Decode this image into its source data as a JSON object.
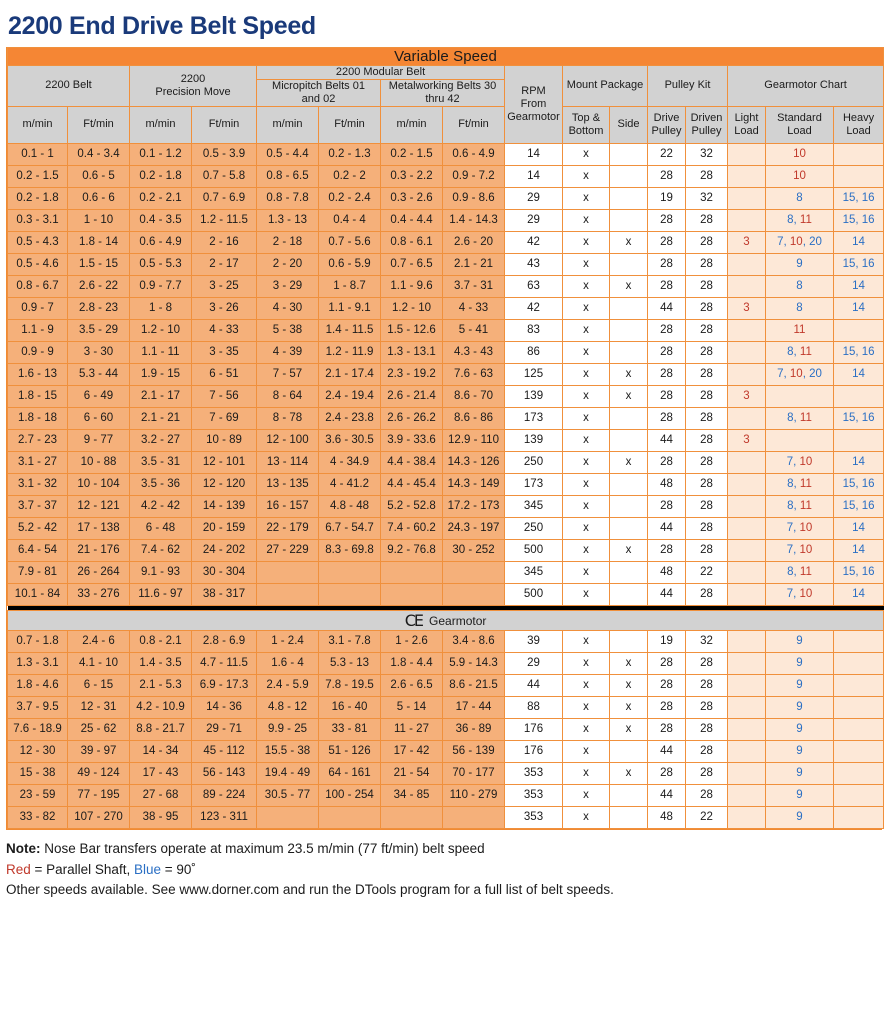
{
  "page_title": "2200 End Drive Belt Speed",
  "colors": {
    "orange_banner": "#f58634",
    "title_blue": "#1a3a7a",
    "parallel_shaft_red": "#c0392b",
    "ninety_degree_blue": "#2a6fc4",
    "speed_cell": "#f5b07a",
    "header_gray": "#d2d2d2",
    "tint_cell": "#fde8d7"
  },
  "banner": {
    "variable_speed": "Variable Speed"
  },
  "ce_section": {
    "mark": "CE",
    "label": "Gearmotor"
  },
  "headers": {
    "group_2200_belt": "2200 Belt",
    "group_precision_move": "2200\nPrecision Move",
    "group_precision_move_l1": "2200",
    "group_precision_move_l2": "Precision Move",
    "group_modular_belt": "2200 Modular Belt",
    "group_micropitch": "Micropitch Belts 01 and 02",
    "group_micropitch_l1": "Micropitch Belts 01",
    "group_micropitch_l2": "and 02",
    "group_metalworking": "Metalworking Belts 30 thru 42",
    "group_metalworking_l1": "Metalworking Belts 30",
    "group_metalworking_l2": "thru 42",
    "rpm_from_gearmotor": "RPM\nFrom\nGearmotor",
    "rpm_l1": "RPM",
    "rpm_l2": "From",
    "rpm_l3": "Gearmotor",
    "mount_package": "Mount Package",
    "top_and_bottom_l1": "Top &",
    "top_and_bottom_l2": "Bottom",
    "side": "Side",
    "pulley_kit": "Pulley Kit",
    "drive_pulley_l1": "Drive",
    "drive_pulley_l2": "Pulley",
    "driven_pulley_l1": "Driven",
    "driven_pulley_l2": "Pulley",
    "gearmotor_chart": "Gearmotor Chart",
    "light_load_l1": "Light",
    "light_load_l2": "Load",
    "standard_load_l1": "Standard",
    "standard_load_l2": "Load",
    "heavy_load_l1": "Heavy",
    "heavy_load_l2": "Load",
    "unit_mmin": "m/min",
    "unit_ftmin": "Ft/min"
  },
  "variable_speed_rows": [
    {
      "belt_m": "0.1 - 1",
      "belt_ft": "0.4 - 3.4",
      "pm_m": "0.1 - 1.2",
      "pm_ft": "0.5 - 3.9",
      "mp_m": "0.5 - 4.4",
      "mp_ft": "0.2 - 1.3",
      "mw_m": "0.2 - 1.5",
      "mw_ft": "0.6 - 4.9",
      "rpm": "14",
      "top": "x",
      "side": "",
      "drive": "22",
      "driven": "32",
      "light": "",
      "standard": [
        {
          "t": "10",
          "c": "red"
        }
      ],
      "heavy": []
    },
    {
      "belt_m": "0.2 - 1.5",
      "belt_ft": "0.6 - 5",
      "pm_m": "0.2 - 1.8",
      "pm_ft": "0.7 - 5.8",
      "mp_m": "0.8 - 6.5",
      "mp_ft": "0.2 - 2",
      "mw_m": "0.3 - 2.2",
      "mw_ft": "0.9 - 7.2",
      "rpm": "14",
      "top": "x",
      "side": "",
      "drive": "28",
      "driven": "28",
      "light": "",
      "standard": [
        {
          "t": "10",
          "c": "red"
        }
      ],
      "heavy": []
    },
    {
      "belt_m": "0.2 - 1.8",
      "belt_ft": "0.6 - 6",
      "pm_m": "0.2 - 2.1",
      "pm_ft": "0.7 - 6.9",
      "mp_m": "0.8 - 7.8",
      "mp_ft": "0.2 - 2.4",
      "mw_m": "0.3 - 2.6",
      "mw_ft": "0.9 - 8.6",
      "rpm": "29",
      "top": "x",
      "side": "",
      "drive": "19",
      "driven": "32",
      "light": "",
      "standard": [
        {
          "t": "8",
          "c": "blue"
        }
      ],
      "heavy": [
        {
          "t": "15, 16",
          "c": "blue"
        }
      ]
    },
    {
      "belt_m": "0.3 - 3.1",
      "belt_ft": "1 - 10",
      "pm_m": "0.4 - 3.5",
      "pm_ft": "1.2 - 11.5",
      "mp_m": "1.3 - 13",
      "mp_ft": "0.4 - 4",
      "mw_m": "0.4 - 4.4",
      "mw_ft": "1.4 - 14.3",
      "rpm": "29",
      "top": "x",
      "side": "",
      "drive": "28",
      "driven": "28",
      "light": "",
      "standard": [
        {
          "t": "8",
          "c": "blue"
        },
        {
          "t": ", ",
          "c": "blue"
        },
        {
          "t": "11",
          "c": "red"
        }
      ],
      "heavy": [
        {
          "t": "15, 16",
          "c": "blue"
        }
      ]
    },
    {
      "belt_m": "0.5 - 4.3",
      "belt_ft": "1.8 - 14",
      "pm_m": "0.6 - 4.9",
      "pm_ft": "2 - 16",
      "mp_m": "2 - 18",
      "mp_ft": "0.7 - 5.6",
      "mw_m": "0.8 - 6.1",
      "mw_ft": "2.6 - 20",
      "rpm": "42",
      "top": "x",
      "side": "x",
      "drive": "28",
      "driven": "28",
      "light": [
        {
          "t": "3",
          "c": "red"
        }
      ],
      "standard": [
        {
          "t": "7",
          "c": "blue"
        },
        {
          "t": ", ",
          "c": "blue"
        },
        {
          "t": "10",
          "c": "red"
        },
        {
          "t": ", ",
          "c": "blue"
        },
        {
          "t": "20",
          "c": "blue"
        }
      ],
      "heavy": [
        {
          "t": "14",
          "c": "blue"
        }
      ]
    },
    {
      "belt_m": "0.5 - 4.6",
      "belt_ft": "1.5 - 15",
      "pm_m": "0.5 - 5.3",
      "pm_ft": "2 - 17",
      "mp_m": "2 - 20",
      "mp_ft": "0.6 - 5.9",
      "mw_m": "0.7 - 6.5",
      "mw_ft": "2.1 - 21",
      "rpm": "43",
      "top": "x",
      "side": "",
      "drive": "28",
      "driven": "28",
      "light": "",
      "standard": [
        {
          "t": "9",
          "c": "blue"
        }
      ],
      "heavy": [
        {
          "t": "15, 16",
          "c": "blue"
        }
      ]
    },
    {
      "belt_m": "0.8 - 6.7",
      "belt_ft": "2.6 - 22",
      "pm_m": "0.9 - 7.7",
      "pm_ft": "3 - 25",
      "mp_m": "3 - 29",
      "mp_ft": "1 - 8.7",
      "mw_m": "1.1 - 9.6",
      "mw_ft": "3.7 - 31",
      "rpm": "63",
      "top": "x",
      "side": "x",
      "drive": "28",
      "driven": "28",
      "light": "",
      "standard": [
        {
          "t": "8",
          "c": "blue"
        }
      ],
      "heavy": [
        {
          "t": "14",
          "c": "blue"
        }
      ]
    },
    {
      "belt_m": "0.9 - 7",
      "belt_ft": "2.8 - 23",
      "pm_m": "1 - 8",
      "pm_ft": "3 - 26",
      "mp_m": "4 - 30",
      "mp_ft": "1.1 - 9.1",
      "mw_m": "1.2 - 10",
      "mw_ft": "4 - 33",
      "rpm": "42",
      "top": "x",
      "side": "",
      "drive": "44",
      "driven": "28",
      "light": [
        {
          "t": "3",
          "c": "red"
        }
      ],
      "standard": [
        {
          "t": "8",
          "c": "blue"
        }
      ],
      "heavy": [
        {
          "t": "14",
          "c": "blue"
        }
      ]
    },
    {
      "belt_m": "1.1 - 9",
      "belt_ft": "3.5 - 29",
      "pm_m": "1.2 - 10",
      "pm_ft": "4 - 33",
      "mp_m": "5 - 38",
      "mp_ft": "1.4 - 11.5",
      "mw_m": "1.5 - 12.6",
      "mw_ft": "5 - 41",
      "rpm": "83",
      "top": "x",
      "side": "",
      "drive": "28",
      "driven": "28",
      "light": "",
      "standard": [
        {
          "t": "11",
          "c": "red"
        }
      ],
      "heavy": []
    },
    {
      "belt_m": "0.9 - 9",
      "belt_ft": "3 - 30",
      "pm_m": "1.1 - 11",
      "pm_ft": "3 - 35",
      "mp_m": "4 - 39",
      "mp_ft": "1.2 - 11.9",
      "mw_m": "1.3 - 13.1",
      "mw_ft": "4.3 - 43",
      "rpm": "86",
      "top": "x",
      "side": "",
      "drive": "28",
      "driven": "28",
      "light": "",
      "standard": [
        {
          "t": "8",
          "c": "blue"
        },
        {
          "t": ", ",
          "c": "blue"
        },
        {
          "t": "11",
          "c": "red"
        }
      ],
      "heavy": [
        {
          "t": "15, 16",
          "c": "blue"
        }
      ]
    },
    {
      "belt_m": "1.6 - 13",
      "belt_ft": "5.3 - 44",
      "pm_m": "1.9 - 15",
      "pm_ft": "6 - 51",
      "mp_m": "7 - 57",
      "mp_ft": "2.1 - 17.4",
      "mw_m": "2.3 - 19.2",
      "mw_ft": "7.6 - 63",
      "rpm": "125",
      "top": "x",
      "side": "x",
      "drive": "28",
      "driven": "28",
      "light": "",
      "standard": [
        {
          "t": "7",
          "c": "blue"
        },
        {
          "t": ", ",
          "c": "blue"
        },
        {
          "t": "10",
          "c": "red"
        },
        {
          "t": ", ",
          "c": "blue"
        },
        {
          "t": "20",
          "c": "blue"
        }
      ],
      "heavy": [
        {
          "t": "14",
          "c": "blue"
        }
      ]
    },
    {
      "belt_m": "1.8 - 15",
      "belt_ft": "6 - 49",
      "pm_m": "2.1 - 17",
      "pm_ft": "7 - 56",
      "mp_m": "8 - 64",
      "mp_ft": "2.4 - 19.4",
      "mw_m": "2.6 - 21.4",
      "mw_ft": "8.6 - 70",
      "rpm": "139",
      "top": "x",
      "side": "x",
      "drive": "28",
      "driven": "28",
      "light": [
        {
          "t": "3",
          "c": "red"
        }
      ],
      "standard": [],
      "heavy": []
    },
    {
      "belt_m": "1.8 - 18",
      "belt_ft": "6 - 60",
      "pm_m": "2.1 - 21",
      "pm_ft": "7 - 69",
      "mp_m": "8 - 78",
      "mp_ft": "2.4 - 23.8",
      "mw_m": "2.6 - 26.2",
      "mw_ft": "8.6 - 86",
      "rpm": "173",
      "top": "x",
      "side": "",
      "drive": "28",
      "driven": "28",
      "light": "",
      "standard": [
        {
          "t": "8",
          "c": "blue"
        },
        {
          "t": ", ",
          "c": "blue"
        },
        {
          "t": "11",
          "c": "red"
        }
      ],
      "heavy": [
        {
          "t": "15, 16",
          "c": "blue"
        }
      ]
    },
    {
      "belt_m": "2.7 - 23",
      "belt_ft": "9 - 77",
      "pm_m": "3.2 - 27",
      "pm_ft": "10 - 89",
      "mp_m": "12 - 100",
      "mp_ft": "3.6 - 30.5",
      "mw_m": "3.9 - 33.6",
      "mw_ft": "12.9 - 110",
      "rpm": "139",
      "top": "x",
      "side": "",
      "drive": "44",
      "driven": "28",
      "light": [
        {
          "t": "3",
          "c": "red"
        }
      ],
      "standard": [],
      "heavy": []
    },
    {
      "belt_m": "3.1 - 27",
      "belt_ft": "10 - 88",
      "pm_m": "3.5 - 31",
      "pm_ft": "12 - 101",
      "mp_m": "13 - 114",
      "mp_ft": "4 - 34.9",
      "mw_m": "4.4 - 38.4",
      "mw_ft": "14.3 - 126",
      "rpm": "250",
      "top": "x",
      "side": "x",
      "drive": "28",
      "driven": "28",
      "light": "",
      "standard": [
        {
          "t": "7",
          "c": "blue"
        },
        {
          "t": ", ",
          "c": "blue"
        },
        {
          "t": "10",
          "c": "red"
        }
      ],
      "heavy": [
        {
          "t": "14",
          "c": "blue"
        }
      ]
    },
    {
      "belt_m": "3.1 - 32",
      "belt_ft": "10 - 104",
      "pm_m": "3.5 - 36",
      "pm_ft": "12 - 120",
      "mp_m": "13 - 135",
      "mp_ft": "4 - 41.2",
      "mw_m": "4.4 - 45.4",
      "mw_ft": "14.3 - 149",
      "rpm": "173",
      "top": "x",
      "side": "",
      "drive": "48",
      "driven": "28",
      "light": "",
      "standard": [
        {
          "t": "8",
          "c": "blue"
        },
        {
          "t": ", ",
          "c": "blue"
        },
        {
          "t": "11",
          "c": "red"
        }
      ],
      "heavy": [
        {
          "t": "15, 16",
          "c": "blue"
        }
      ]
    },
    {
      "belt_m": "3.7 - 37",
      "belt_ft": "12 - 121",
      "pm_m": "4.2 - 42",
      "pm_ft": "14 - 139",
      "mp_m": "16 - 157",
      "mp_ft": "4.8 - 48",
      "mw_m": "5.2 - 52.8",
      "mw_ft": "17.2 - 173",
      "rpm": "345",
      "top": "x",
      "side": "",
      "drive": "28",
      "driven": "28",
      "light": "",
      "standard": [
        {
          "t": "8",
          "c": "blue"
        },
        {
          "t": ", ",
          "c": "blue"
        },
        {
          "t": "11",
          "c": "red"
        }
      ],
      "heavy": [
        {
          "t": "15, 16",
          "c": "blue"
        }
      ]
    },
    {
      "belt_m": "5.2 - 42",
      "belt_ft": "17 - 138",
      "pm_m": "6 - 48",
      "pm_ft": "20 - 159",
      "mp_m": "22 - 179",
      "mp_ft": "6.7 - 54.7",
      "mw_m": "7.4 - 60.2",
      "mw_ft": "24.3 - 197",
      "rpm": "250",
      "top": "x",
      "side": "",
      "drive": "44",
      "driven": "28",
      "light": "",
      "standard": [
        {
          "t": "7",
          "c": "blue"
        },
        {
          "t": ", ",
          "c": "blue"
        },
        {
          "t": "10",
          "c": "red"
        }
      ],
      "heavy": [
        {
          "t": "14",
          "c": "blue"
        }
      ]
    },
    {
      "belt_m": "6.4 - 54",
      "belt_ft": "21 - 176",
      "pm_m": "7.4 - 62",
      "pm_ft": "24 - 202",
      "mp_m": "27 - 229",
      "mp_ft": "8.3 - 69.8",
      "mw_m": "9.2 - 76.8",
      "mw_ft": "30 - 252",
      "rpm": "500",
      "top": "x",
      "side": "x",
      "drive": "28",
      "driven": "28",
      "light": "",
      "standard": [
        {
          "t": "7",
          "c": "blue"
        },
        {
          "t": ", ",
          "c": "blue"
        },
        {
          "t": "10",
          "c": "red"
        }
      ],
      "heavy": [
        {
          "t": "14",
          "c": "blue"
        }
      ]
    },
    {
      "belt_m": "7.9 - 81",
      "belt_ft": "26 - 264",
      "pm_m": "9.1 - 93",
      "pm_ft": "30 - 304",
      "mp_m": "",
      "mp_ft": "",
      "mw_m": "",
      "mw_ft": "",
      "rpm": "345",
      "top": "x",
      "side": "",
      "drive": "48",
      "driven": "22",
      "light": "",
      "standard": [
        {
          "t": "8",
          "c": "blue"
        },
        {
          "t": ", ",
          "c": "blue"
        },
        {
          "t": "11",
          "c": "red"
        }
      ],
      "heavy": [
        {
          "t": "15, 16",
          "c": "blue"
        }
      ]
    },
    {
      "belt_m": "10.1 - 84",
      "belt_ft": "33 - 276",
      "pm_m": "11.6 - 97",
      "pm_ft": "38 - 317",
      "mp_m": "",
      "mp_ft": "",
      "mw_m": "",
      "mw_ft": "",
      "rpm": "500",
      "top": "x",
      "side": "",
      "drive": "44",
      "driven": "28",
      "light": "",
      "standard": [
        {
          "t": "7",
          "c": "blue"
        },
        {
          "t": ", ",
          "c": "blue"
        },
        {
          "t": "10",
          "c": "red"
        }
      ],
      "heavy": [
        {
          "t": "14",
          "c": "blue"
        }
      ]
    }
  ],
  "ce_gearmotor_rows": [
    {
      "belt_m": "0.7 - 1.8",
      "belt_ft": "2.4 - 6",
      "pm_m": "0.8 - 2.1",
      "pm_ft": "2.8 - 6.9",
      "mp_m": "1 - 2.4",
      "mp_ft": "3.1 - 7.8",
      "mw_m": "1 - 2.6",
      "mw_ft": "3.4 - 8.6",
      "rpm": "39",
      "top": "x",
      "side": "",
      "drive": "19",
      "driven": "32",
      "light": "",
      "standard": [
        {
          "t": "9",
          "c": "blue"
        }
      ],
      "heavy": []
    },
    {
      "belt_m": "1.3 - 3.1",
      "belt_ft": "4.1 - 10",
      "pm_m": "1.4 - 3.5",
      "pm_ft": "4.7 - 11.5",
      "mp_m": "1.6 - 4",
      "mp_ft": "5.3 - 13",
      "mw_m": "1.8 - 4.4",
      "mw_ft": "5.9 - 14.3",
      "rpm": "29",
      "top": "x",
      "side": "x",
      "drive": "28",
      "driven": "28",
      "light": "",
      "standard": [
        {
          "t": "9",
          "c": "blue"
        }
      ],
      "heavy": []
    },
    {
      "belt_m": "1.8 - 4.6",
      "belt_ft": "6 - 15",
      "pm_m": "2.1 - 5.3",
      "pm_ft": "6.9 - 17.3",
      "mp_m": "2.4 - 5.9",
      "mp_ft": "7.8 - 19.5",
      "mw_m": "2.6 - 6.5",
      "mw_ft": "8.6 - 21.5",
      "rpm": "44",
      "top": "x",
      "side": "x",
      "drive": "28",
      "driven": "28",
      "light": "",
      "standard": [
        {
          "t": "9",
          "c": "blue"
        }
      ],
      "heavy": []
    },
    {
      "belt_m": "3.7 - 9.5",
      "belt_ft": "12 - 31",
      "pm_m": "4.2 - 10.9",
      "pm_ft": "14 - 36",
      "mp_m": "4.8 - 12",
      "mp_ft": "16 - 40",
      "mw_m": "5 - 14",
      "mw_ft": "17 - 44",
      "rpm": "88",
      "top": "x",
      "side": "x",
      "drive": "28",
      "driven": "28",
      "light": "",
      "standard": [
        {
          "t": "9",
          "c": "blue"
        }
      ],
      "heavy": []
    },
    {
      "belt_m": "7.6 - 18.9",
      "belt_ft": "25 - 62",
      "pm_m": "8.8 - 21.7",
      "pm_ft": "29 - 71",
      "mp_m": "9.9 - 25",
      "mp_ft": "33 - 81",
      "mw_m": "11 - 27",
      "mw_ft": "36 - 89",
      "rpm": "176",
      "top": "x",
      "side": "x",
      "drive": "28",
      "driven": "28",
      "light": "",
      "standard": [
        {
          "t": "9",
          "c": "blue"
        }
      ],
      "heavy": []
    },
    {
      "belt_m": "12 - 30",
      "belt_ft": "39 - 97",
      "pm_m": "14 - 34",
      "pm_ft": "45 - 112",
      "mp_m": "15.5 - 38",
      "mp_ft": "51 - 126",
      "mw_m": "17 - 42",
      "mw_ft": "56 - 139",
      "rpm": "176",
      "top": "x",
      "side": "",
      "drive": "44",
      "driven": "28",
      "light": "",
      "standard": [
        {
          "t": "9",
          "c": "blue"
        }
      ],
      "heavy": []
    },
    {
      "belt_m": "15 - 38",
      "belt_ft": "49 - 124",
      "pm_m": "17 - 43",
      "pm_ft": "56 - 143",
      "mp_m": "19.4 - 49",
      "mp_ft": "64 - 161",
      "mw_m": "21 - 54",
      "mw_ft": "70 - 177",
      "rpm": "353",
      "top": "x",
      "side": "x",
      "drive": "28",
      "driven": "28",
      "light": "",
      "standard": [
        {
          "t": "9",
          "c": "blue"
        }
      ],
      "heavy": []
    },
    {
      "belt_m": "23 - 59",
      "belt_ft": "77 - 195",
      "pm_m": "27 - 68",
      "pm_ft": "89 - 224",
      "mp_m": "30.5 - 77",
      "mp_ft": "100 - 254",
      "mw_m": "34 - 85",
      "mw_ft": "110 - 279",
      "rpm": "353",
      "top": "x",
      "side": "",
      "drive": "44",
      "driven": "28",
      "light": "",
      "standard": [
        {
          "t": "9",
          "c": "blue"
        }
      ],
      "heavy": []
    },
    {
      "belt_m": "33 - 82",
      "belt_ft": "107 - 270",
      "pm_m": "38 - 95",
      "pm_ft": "123 - 311",
      "mp_m": "",
      "mp_ft": "",
      "mw_m": "",
      "mw_ft": "",
      "rpm": "353",
      "top": "x",
      "side": "",
      "drive": "48",
      "driven": "22",
      "light": "",
      "standard": [
        {
          "t": "9",
          "c": "blue"
        }
      ],
      "heavy": []
    }
  ],
  "notes": {
    "note_label": "Note:",
    "note_text": " Nose Bar transfers operate at maximum 23.5 m/min (77 ft/min) belt speed",
    "legend_red": "Red",
    "legend_red_text": " = Parallel Shaft, ",
    "legend_blue": "Blue",
    "legend_blue_text": " = 90˚",
    "other_speeds": "Other speeds available. See www.dorner.com and run the DTools program for a full list of belt speeds."
  }
}
